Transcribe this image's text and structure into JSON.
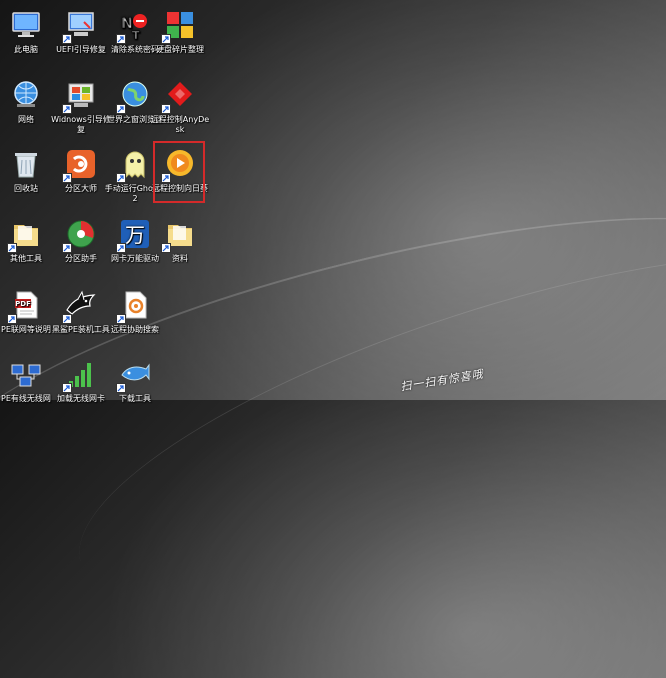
{
  "desktop": {
    "icons": [
      {
        "label": "此电脑",
        "icon": "computer-icon"
      },
      {
        "label": "UEFI引导修复",
        "icon": "uefi-repair-icon"
      },
      {
        "label": "清除系统密码",
        "icon": "clear-password-icon"
      },
      {
        "label": "硬盘碎片整理",
        "icon": "disk-defrag-icon"
      },
      {
        "label": "网络",
        "icon": "network-icon"
      },
      {
        "label": "Widnows引导修复",
        "icon": "windows-boot-repair-icon"
      },
      {
        "label": "世界之窗浏览器",
        "icon": "browser-icon"
      },
      {
        "label": "远程控制AnyDesk",
        "icon": "anydesk-icon"
      },
      {
        "label": "回收站",
        "icon": "recycle-bin-icon"
      },
      {
        "label": "分区大师",
        "icon": "partition-master-icon"
      },
      {
        "label": "手动运行Ghost12",
        "icon": "ghost-icon"
      },
      {
        "label": "远程控制向日葵",
        "icon": "sunflower-icon"
      },
      {
        "label": "其他工具",
        "icon": "folder-icon"
      },
      {
        "label": "分区助手",
        "icon": "partition-assistant-icon"
      },
      {
        "label": "网卡万能驱动",
        "icon": "nic-driver-icon"
      },
      {
        "label": "资料",
        "icon": "folder-icon"
      },
      {
        "label": "PE联网等说明",
        "icon": "pdf-icon"
      },
      {
        "label": "黑鲨PE装机工具",
        "icon": "blackshark-icon"
      },
      {
        "label": "远程协助搜索",
        "icon": "remote-assist-icon"
      },
      {
        "label": "PE有线无线网",
        "icon": "pe-network-icon"
      },
      {
        "label": "加载无线网卡",
        "icon": "wifi-signal-icon"
      },
      {
        "label": "下载工具",
        "icon": "download-tool-icon"
      }
    ]
  },
  "watermark": {
    "text": "扫一扫有惊喜哦"
  },
  "colors": {
    "selection": "#d42a2a"
  }
}
